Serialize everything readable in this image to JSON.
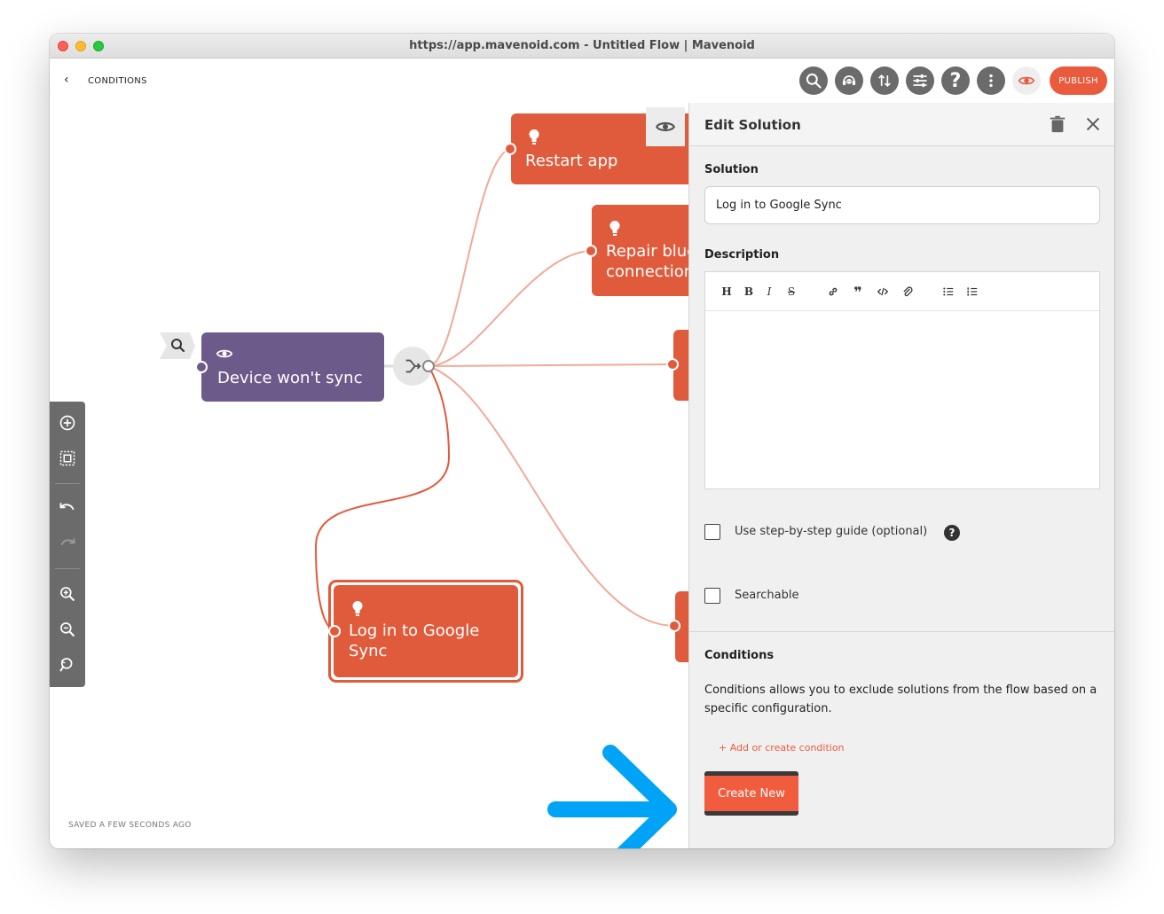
{
  "window": {
    "title": "https://app.mavenoid.com - Untitled Flow | Mavenoid"
  },
  "topbar": {
    "back_label": "‹",
    "page_title": "CONDITIONS",
    "icons": [
      "search-icon",
      "support-agent-icon",
      "sort-icon",
      "sliders-icon",
      "help-icon",
      "more-vertical-icon",
      "eye-icon"
    ],
    "help_glyph": "?",
    "publish_label": "PUBLISH"
  },
  "canvas": {
    "tools": [
      "add-circle-icon",
      "select-area-icon",
      "undo-icon",
      "redo-icon",
      "zoom-in-icon",
      "zoom-out-icon",
      "zoom-reset-icon"
    ],
    "nodes": {
      "start": "Device won't sync",
      "restart": "Restart app",
      "repair_line1": "Repair blue",
      "repair_line2": "connection",
      "google_line1": "Log in to Google",
      "google_line2": "Sync"
    },
    "saved_status": "SAVED A FEW SECONDS AGO"
  },
  "panel": {
    "title": "Edit Solution",
    "solution_label": "Solution",
    "solution_value": "Log in to Google Sync",
    "description_label": "Description",
    "editor_tools": {
      "heading": "H",
      "bold": "B",
      "italic": "I",
      "strike": "S",
      "quote": "❞"
    },
    "step_guide_label": "Use step-by-step guide (optional)",
    "help_glyph": "?",
    "searchable_label": "Searchable",
    "conditions_label": "Conditions",
    "conditions_desc": "Conditions allows you to exclude solutions from the flow based on a specific configuration.",
    "add_condition_label": "+   Add or create condition",
    "create_new_label": "Create New"
  },
  "colors": {
    "accent": "#ea5a3d",
    "node_orange": "#e05b3c",
    "node_purple": "#6c5a8a",
    "arrow_blue": "#00a3f5",
    "toolbar_gray": "#6b6b6b"
  }
}
